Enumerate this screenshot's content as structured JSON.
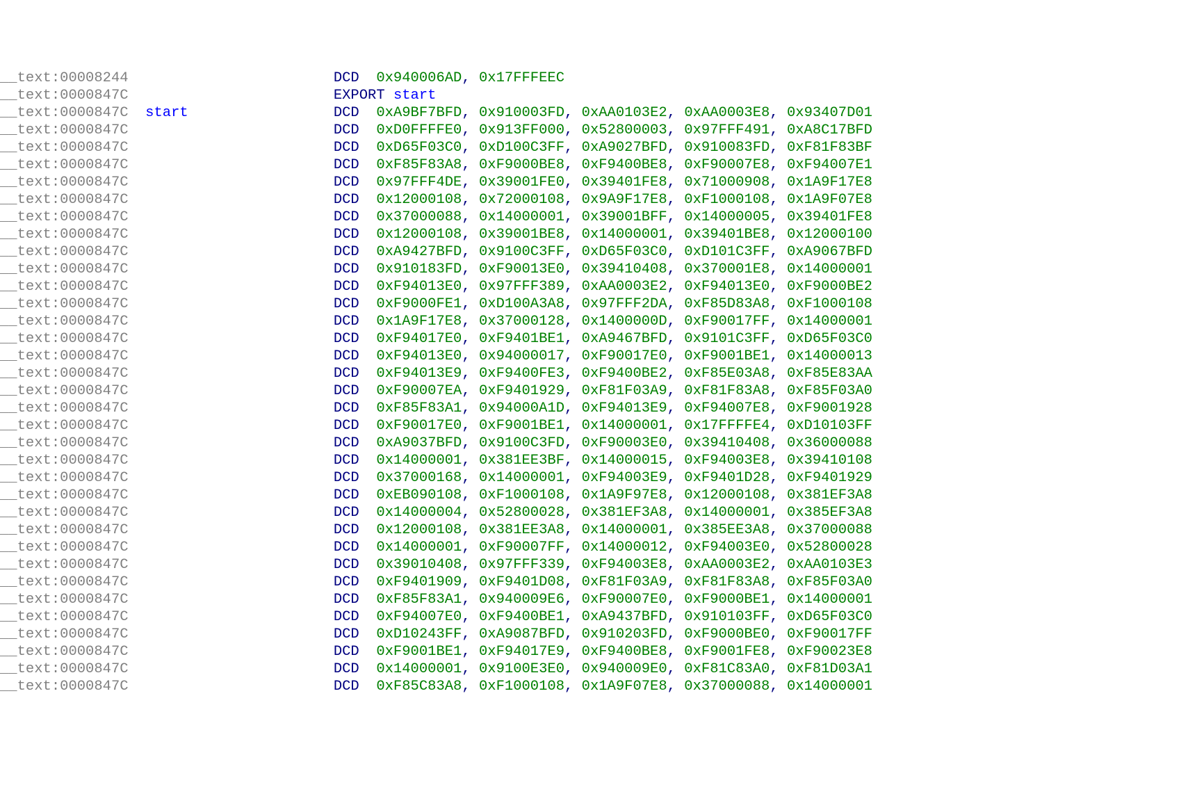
{
  "prefix": "__",
  "segment": "text",
  "addressPrefix": ":",
  "lines": [
    {
      "addr": "00008244",
      "label": "",
      "op": "DCD",
      "vals": [
        "0x940006AD",
        "0x17FFFEEC"
      ]
    },
    {
      "addr": "0000847C",
      "label": "",
      "op": "EXPORT",
      "exportName": "start"
    },
    {
      "addr": "0000847C",
      "label": "start",
      "op": "DCD",
      "vals": [
        "0xA9BF7BFD",
        "0x910003FD",
        "0xAA0103E2",
        "0xAA0003E8",
        "0x93407D01"
      ]
    },
    {
      "addr": "0000847C",
      "label": "",
      "op": "DCD",
      "vals": [
        "0xD0FFFFE0",
        "0x913FF000",
        "0x52800003",
        "0x97FFF491",
        "0xA8C17BFD"
      ]
    },
    {
      "addr": "0000847C",
      "label": "",
      "op": "DCD",
      "vals": [
        "0xD65F03C0",
        "0xD100C3FF",
        "0xA9027BFD",
        "0x910083FD",
        "0xF81F83BF"
      ]
    },
    {
      "addr": "0000847C",
      "label": "",
      "op": "DCD",
      "vals": [
        "0xF85F83A8",
        "0xF9000BE8",
        "0xF9400BE8",
        "0xF90007E8",
        "0xF94007E1"
      ]
    },
    {
      "addr": "0000847C",
      "label": "",
      "op": "DCD",
      "vals": [
        "0x97FFF4DE",
        "0x39001FE0",
        "0x39401FE8",
        "0x71000908",
        "0x1A9F17E8"
      ]
    },
    {
      "addr": "0000847C",
      "label": "",
      "op": "DCD",
      "vals": [
        "0x12000108",
        "0x72000108",
        "0x9A9F17E8",
        "0xF1000108",
        "0x1A9F07E8"
      ]
    },
    {
      "addr": "0000847C",
      "label": "",
      "op": "DCD",
      "vals": [
        "0x37000088",
        "0x14000001",
        "0x39001BFF",
        "0x14000005",
        "0x39401FE8"
      ]
    },
    {
      "addr": "0000847C",
      "label": "",
      "op": "DCD",
      "vals": [
        "0x12000108",
        "0x39001BE8",
        "0x14000001",
        "0x39401BE8",
        "0x12000100"
      ]
    },
    {
      "addr": "0000847C",
      "label": "",
      "op": "DCD",
      "vals": [
        "0xA9427BFD",
        "0x9100C3FF",
        "0xD65F03C0",
        "0xD101C3FF",
        "0xA9067BFD"
      ]
    },
    {
      "addr": "0000847C",
      "label": "",
      "op": "DCD",
      "vals": [
        "0x910183FD",
        "0xF90013E0",
        "0x39410408",
        "0x370001E8",
        "0x14000001"
      ]
    },
    {
      "addr": "0000847C",
      "label": "",
      "op": "DCD",
      "vals": [
        "0xF94013E0",
        "0x97FFF389",
        "0xAA0003E2",
        "0xF94013E0",
        "0xF9000BE2"
      ]
    },
    {
      "addr": "0000847C",
      "label": "",
      "op": "DCD",
      "vals": [
        "0xF9000FE1",
        "0xD100A3A8",
        "0x97FFF2DA",
        "0xF85D83A8",
        "0xF1000108"
      ]
    },
    {
      "addr": "0000847C",
      "label": "",
      "op": "DCD",
      "vals": [
        "0x1A9F17E8",
        "0x37000128",
        "0x1400000D",
        "0xF90017FF",
        "0x14000001"
      ]
    },
    {
      "addr": "0000847C",
      "label": "",
      "op": "DCD",
      "vals": [
        "0xF94017E0",
        "0xF9401BE1",
        "0xA9467BFD",
        "0x9101C3FF",
        "0xD65F03C0"
      ]
    },
    {
      "addr": "0000847C",
      "label": "",
      "op": "DCD",
      "vals": [
        "0xF94013E0",
        "0x94000017",
        "0xF90017E0",
        "0xF9001BE1",
        "0x14000013"
      ]
    },
    {
      "addr": "0000847C",
      "label": "",
      "op": "DCD",
      "vals": [
        "0xF94013E9",
        "0xF9400FE3",
        "0xF9400BE2",
        "0xF85E03A8",
        "0xF85E83AA"
      ]
    },
    {
      "addr": "0000847C",
      "label": "",
      "op": "DCD",
      "vals": [
        "0xF90007EA",
        "0xF9401929",
        "0xF81F03A9",
        "0xF81F83A8",
        "0xF85F03A0"
      ]
    },
    {
      "addr": "0000847C",
      "label": "",
      "op": "DCD",
      "vals": [
        "0xF85F83A1",
        "0x94000A1D",
        "0xF94013E9",
        "0xF94007E8",
        "0xF9001928"
      ]
    },
    {
      "addr": "0000847C",
      "label": "",
      "op": "DCD",
      "vals": [
        "0xF90017E0",
        "0xF9001BE1",
        "0x14000001",
        "0x17FFFFE4",
        "0xD10103FF"
      ]
    },
    {
      "addr": "0000847C",
      "label": "",
      "op": "DCD",
      "vals": [
        "0xA9037BFD",
        "0x9100C3FD",
        "0xF90003E0",
        "0x39410408",
        "0x36000088"
      ]
    },
    {
      "addr": "0000847C",
      "label": "",
      "op": "DCD",
      "vals": [
        "0x14000001",
        "0x381EE3BF",
        "0x14000015",
        "0xF94003E8",
        "0x39410108"
      ]
    },
    {
      "addr": "0000847C",
      "label": "",
      "op": "DCD",
      "vals": [
        "0x37000168",
        "0x14000001",
        "0xF94003E9",
        "0xF9401D28",
        "0xF9401929"
      ]
    },
    {
      "addr": "0000847C",
      "label": "",
      "op": "DCD",
      "vals": [
        "0xEB090108",
        "0xF1000108",
        "0x1A9F97E8",
        "0x12000108",
        "0x381EF3A8"
      ]
    },
    {
      "addr": "0000847C",
      "label": "",
      "op": "DCD",
      "vals": [
        "0x14000004",
        "0x52800028",
        "0x381EF3A8",
        "0x14000001",
        "0x385EF3A8"
      ]
    },
    {
      "addr": "0000847C",
      "label": "",
      "op": "DCD",
      "vals": [
        "0x12000108",
        "0x381EE3A8",
        "0x14000001",
        "0x385EE3A8",
        "0x37000088"
      ]
    },
    {
      "addr": "0000847C",
      "label": "",
      "op": "DCD",
      "vals": [
        "0x14000001",
        "0xF90007FF",
        "0x14000012",
        "0xF94003E0",
        "0x52800028"
      ]
    },
    {
      "addr": "0000847C",
      "label": "",
      "op": "DCD",
      "vals": [
        "0x39010408",
        "0x97FFF339",
        "0xF94003E8",
        "0xAA0003E2",
        "0xAA0103E3"
      ]
    },
    {
      "addr": "0000847C",
      "label": "",
      "op": "DCD",
      "vals": [
        "0xF9401909",
        "0xF9401D08",
        "0xF81F03A9",
        "0xF81F83A8",
        "0xF85F03A0"
      ]
    },
    {
      "addr": "0000847C",
      "label": "",
      "op": "DCD",
      "vals": [
        "0xF85F83A1",
        "0x940009E6",
        "0xF90007E0",
        "0xF9000BE1",
        "0x14000001"
      ]
    },
    {
      "addr": "0000847C",
      "label": "",
      "op": "DCD",
      "vals": [
        "0xF94007E0",
        "0xF9400BE1",
        "0xA9437BFD",
        "0x910103FF",
        "0xD65F03C0"
      ]
    },
    {
      "addr": "0000847C",
      "label": "",
      "op": "DCD",
      "vals": [
        "0xD10243FF",
        "0xA9087BFD",
        "0x910203FD",
        "0xF9000BE0",
        "0xF90017FF"
      ]
    },
    {
      "addr": "0000847C",
      "label": "",
      "op": "DCD",
      "vals": [
        "0xF9001BE1",
        "0xF94017E9",
        "0xF9400BE8",
        "0xF9001FE8",
        "0xF90023E8"
      ]
    },
    {
      "addr": "0000847C",
      "label": "",
      "op": "DCD",
      "vals": [
        "0x14000001",
        "0x9100E3E0",
        "0x940009E0",
        "0xF81C83A0",
        "0xF81D03A1"
      ]
    },
    {
      "addr": "0000847C",
      "label": "",
      "op": "DCD",
      "vals": [
        "0xF85C83A8",
        "0xF1000108",
        "0x1A9F07E8",
        "0x37000088",
        "0x14000001"
      ]
    }
  ]
}
